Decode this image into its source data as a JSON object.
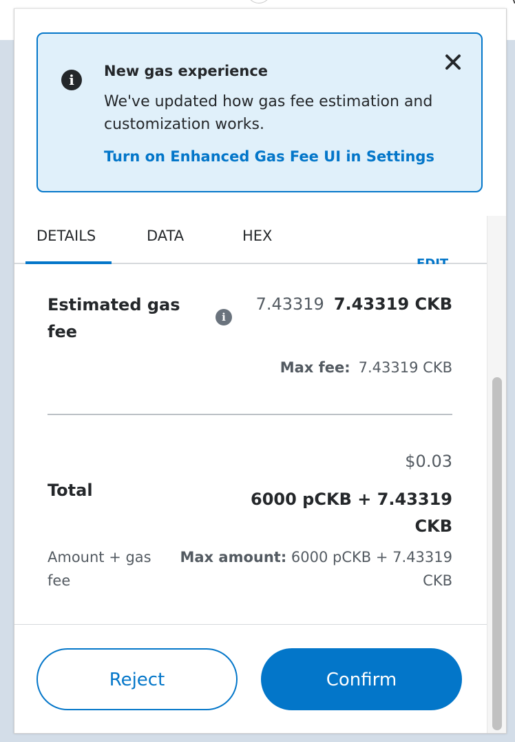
{
  "notice": {
    "title": "New gas experience",
    "body": "We've updated how gas fee estimation and customization works.",
    "link": "Turn on Enhanced Gas Fee UI in Settings"
  },
  "tabs": [
    {
      "label": "DETAILS",
      "active": true
    },
    {
      "label": "DATA",
      "active": false
    },
    {
      "label": "HEX",
      "active": false
    }
  ],
  "edit_label": "EDIT",
  "gas": {
    "label": "Estimated gas fee",
    "secondary_value": "7.43319",
    "primary_value": "7.43319 CKB",
    "max_fee_label": "Max fee:",
    "max_fee_value": "7.43319 CKB"
  },
  "total": {
    "fiat": "$0.03",
    "label": "Total",
    "value": "6000 pCKB + 7.43319 CKB",
    "sub_label": "Amount + gas fee",
    "max_amount_label": "Max amount:",
    "max_amount_value": "6000 pCKB + 7.43319 CKB"
  },
  "buttons": {
    "reject": "Reject",
    "confirm": "Confirm"
  },
  "colors": {
    "accent": "#0376c9",
    "notice_bg": "#e0f0fa",
    "text": "#24272a"
  }
}
